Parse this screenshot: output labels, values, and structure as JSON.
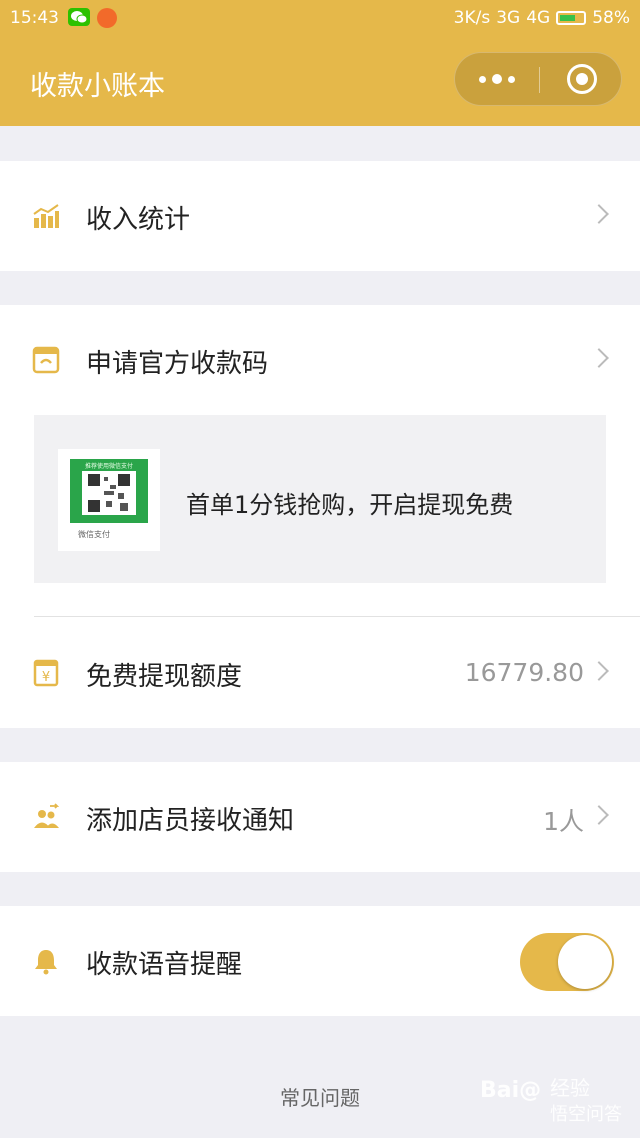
{
  "status_bar": {
    "time": "15:43",
    "network_speed": "3K/s",
    "network_3g": "3G",
    "network_4g": "4G",
    "battery": "58%"
  },
  "nav": {
    "title": "收款小账本"
  },
  "menu": {
    "income_stats": "收入统计",
    "apply_code": "申请官方收款码",
    "promo_text": "首单1分钱抢购，开启提现免费",
    "qr_caption": "推荐使用微信支付",
    "qr_footer": "微信支付",
    "free_quota_label": "免费提现额度",
    "free_quota_value": "16779.80",
    "add_staff_label": "添加店员接收通知",
    "add_staff_value": "1人",
    "voice_label": "收款语音提醒"
  },
  "footer": {
    "faq": "常见问题"
  },
  "watermark": {
    "brand": "Bai@",
    "line1": "经验",
    "line2": "悟空问答"
  },
  "colors": {
    "accent": "#e5b84a",
    "background": "#efeff4"
  }
}
